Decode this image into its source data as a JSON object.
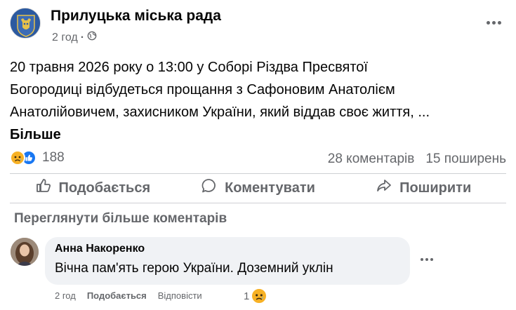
{
  "post": {
    "page_name": "Прилуцька міська рада",
    "time": "2 год",
    "privacy_icon": "globe-icon",
    "text_lines": [
      "20 травня 2026 року о 13:00 у Соборі Різдва Пресвятої",
      "Богородиці відбудеться прощання з Сафоновим Анатолієм",
      "Анатолійовичем, захисником України, який віддав своє життя, ..."
    ],
    "see_more": "Більше"
  },
  "stats": {
    "reactions_count": "188",
    "comments": "28 коментарів",
    "shares": "15 поширень"
  },
  "actions": {
    "like": "Подобається",
    "comment": "Коментувати",
    "share": "Поширити"
  },
  "comments": {
    "view_more": "Переглянути більше коментарів",
    "items": [
      {
        "author": "Анна Накоренко",
        "text": "Вічна пам'ять герою України. Доземний уклін",
        "time": "2 год",
        "like": "Подобається",
        "reply": "Відповісти",
        "reaction_count": "1"
      }
    ]
  },
  "colors": {
    "accent": "#1877f2",
    "secondary_text": "#65676b",
    "sad_reaction": "#f7b125",
    "bubble_bg": "#f0f2f5"
  }
}
